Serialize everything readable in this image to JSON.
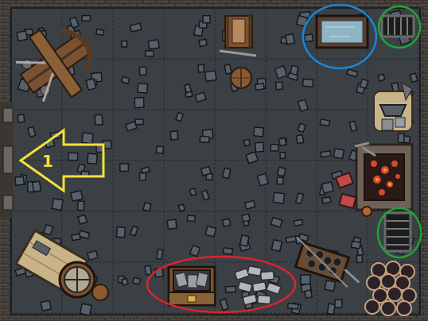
{
  "map": {
    "title": "",
    "grid": true,
    "colors": {
      "wall": "#4a4541",
      "wall_edge": "#2b2724",
      "floor": "#3b4045",
      "grid": "#2b2e32",
      "stone": "#56606a",
      "stone_edge": "#1e2125",
      "wood": "#7a5232",
      "wood_dark": "#4a301c",
      "fire": "#d9482a",
      "water": "#8fb4c4"
    }
  },
  "entrance": {
    "number": "1",
    "arrow_color": "#f2e23a",
    "icon": "arrow-left-icon"
  },
  "highlights": [
    {
      "name": "water-trough-highlight",
      "color": "#1a86d6"
    },
    {
      "name": "floor-grate-top-highlight",
      "color": "#21a336"
    },
    {
      "name": "floor-grate-right-highlight",
      "color": "#21a336"
    },
    {
      "name": "treasure-chest-highlight",
      "color": "#d9262a"
    }
  ],
  "objects": [
    {
      "name": "siege-ballista",
      "icon": "ballista-icon"
    },
    {
      "name": "weapon-rack",
      "icon": "weapon-rack-icon"
    },
    {
      "name": "wooden-barrel",
      "icon": "barrel-icon"
    },
    {
      "name": "water-trough",
      "icon": "trough-icon"
    },
    {
      "name": "floor-grate-top",
      "icon": "grate-icon"
    },
    {
      "name": "anvil",
      "icon": "anvil-icon"
    },
    {
      "name": "forge",
      "icon": "forge-icon"
    },
    {
      "name": "floor-grate-right",
      "icon": "grate-icon"
    },
    {
      "name": "ore-cart",
      "icon": "cart-icon"
    },
    {
      "name": "coal-pile",
      "icon": "coal-icon"
    },
    {
      "name": "treasure-chest",
      "icon": "chest-icon"
    },
    {
      "name": "silver-ingots",
      "icon": "ingot-icon"
    },
    {
      "name": "grinding-wheel-cart",
      "icon": "grindstone-icon"
    }
  ]
}
